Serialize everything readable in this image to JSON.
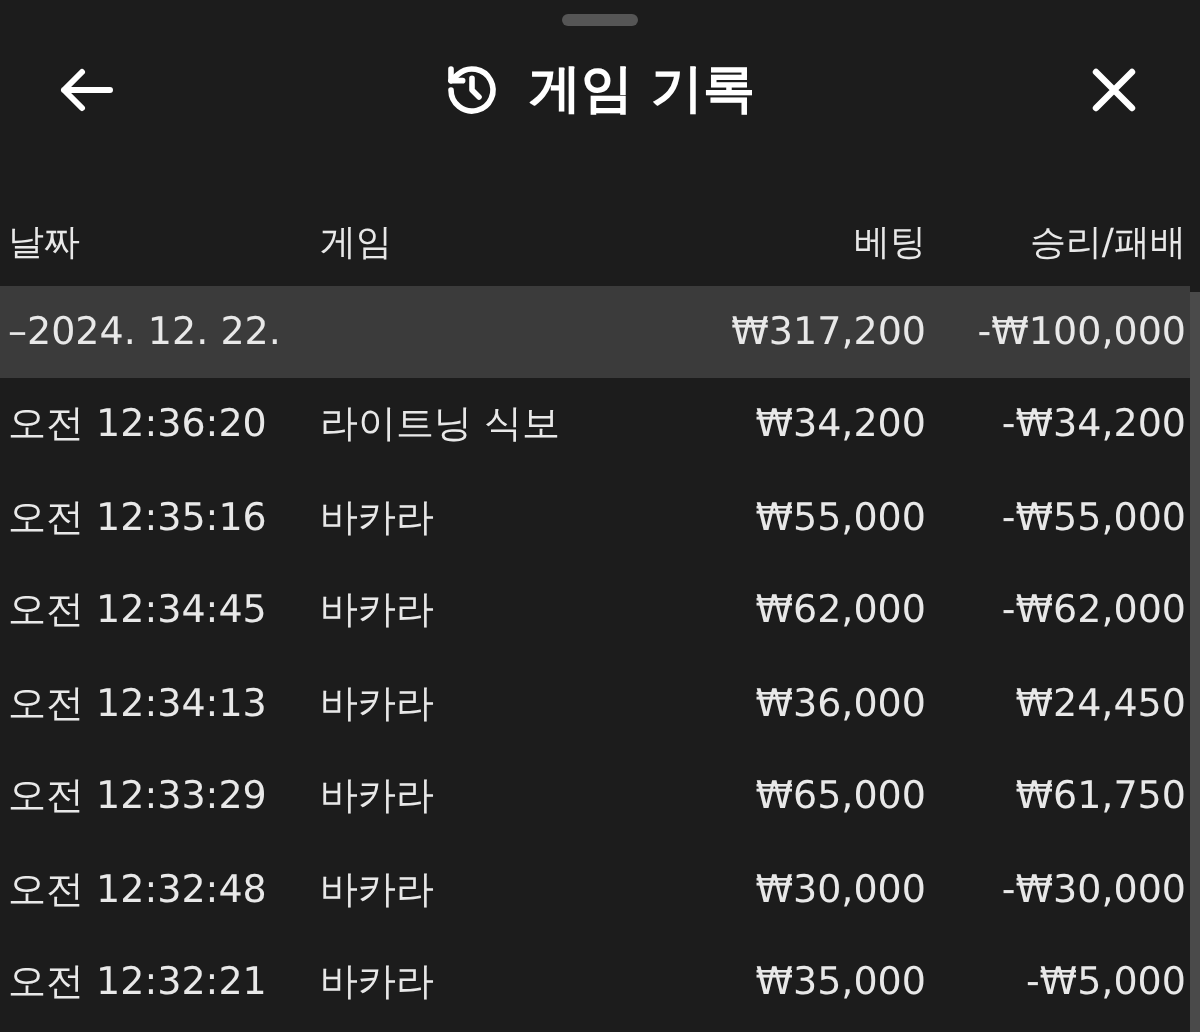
{
  "header": {
    "title": "게임 기록"
  },
  "table": {
    "columns": [
      "날짜",
      "게임",
      "베팅",
      "승리/패배"
    ],
    "group": {
      "date": "–2024. 12. 22.",
      "bet": "₩317,200",
      "result": "-₩100,000"
    },
    "rows": [
      {
        "time": "오전 12:36:20",
        "game": "라이트닝 식보",
        "bet": "₩34,200",
        "result": "-₩34,200"
      },
      {
        "time": "오전 12:35:16",
        "game": "바카라",
        "bet": "₩55,000",
        "result": "-₩55,000"
      },
      {
        "time": "오전 12:34:45",
        "game": "바카라",
        "bet": "₩62,000",
        "result": "-₩62,000"
      },
      {
        "time": "오전 12:34:13",
        "game": "바카라",
        "bet": "₩36,000",
        "result": "₩24,450"
      },
      {
        "time": "오전 12:33:29",
        "game": "바카라",
        "bet": "₩65,000",
        "result": "₩61,750"
      },
      {
        "time": "오전 12:32:48",
        "game": "바카라",
        "bet": "₩30,000",
        "result": "-₩30,000"
      },
      {
        "time": "오전 12:32:21",
        "game": "바카라",
        "bet": "₩35,000",
        "result": "-₩5,000"
      }
    ]
  }
}
